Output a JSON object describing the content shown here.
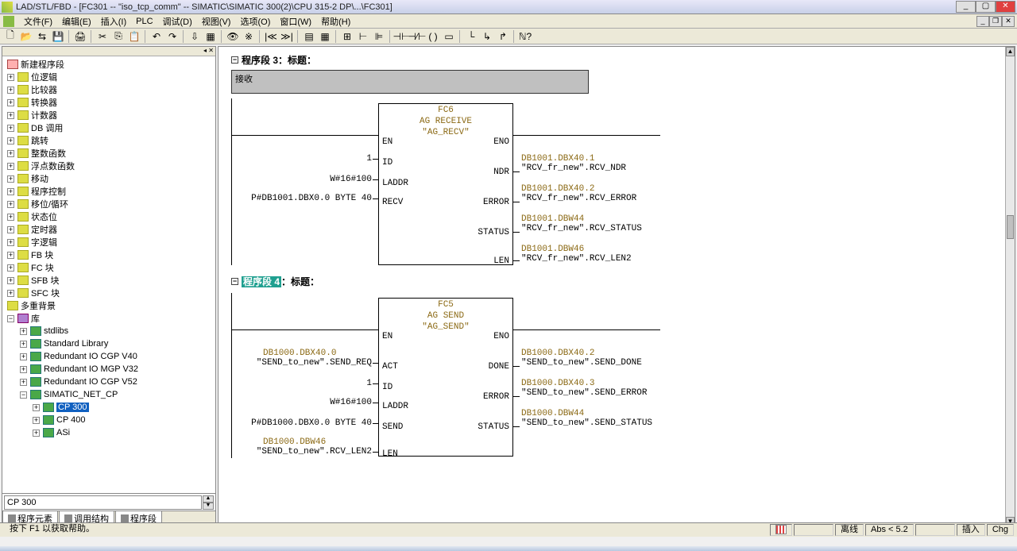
{
  "window": {
    "title": "LAD/STL/FBD  - [FC301 -- \"iso_tcp_comm\" -- SIMATIC\\SIMATIC 300(2)\\CPU 315-2 DP\\...\\FC301]"
  },
  "menu": {
    "file": "文件(F)",
    "edit": "编辑(E)",
    "insert": "插入(I)",
    "plc": "PLC",
    "debug": "调试(D)",
    "view": "视图(V)",
    "options": "选项(O)",
    "window": "窗口(W)",
    "help": "帮助(H)"
  },
  "tree": {
    "new_nw": "新建程序段",
    "bit_logic": "位逻辑",
    "compare": "比较器",
    "convert": "转换器",
    "counter": "计数器",
    "db_call": "DB 调用",
    "jumps": "跳转",
    "int_fn": "整数函数",
    "float_fn": "浮点数函数",
    "move": "移动",
    "prg_ctrl": "程序控制",
    "shift_rot": "移位/循环",
    "status": "状态位",
    "timer": "定时器",
    "word_logic": "字逻辑",
    "fb_blocks": "FB 块",
    "fc_blocks": "FC 块",
    "sfb_blocks": "SFB 块",
    "sfc_blocks": "SFC 块",
    "multi_inst": "多重背景",
    "library": "库",
    "stdlibs": "stdlibs",
    "std_library": "Standard Library",
    "red_io_v40": "Redundant IO CGP V40",
    "red_io_mgp": "Redundant IO MGP V32",
    "red_io_v52": "Redundant IO CGP V52",
    "simatic_net": "SIMATIC_NET_CP",
    "cp300": "CP 300",
    "cp400": "CP 400",
    "asi": "ASi"
  },
  "bottom_input": "CP 300",
  "bottom_tabs": {
    "elements": "程序元素",
    "call_struct": "调用结构",
    "networks": "程序段"
  },
  "network3": {
    "header_label": "程序段 3",
    "header_title": "：标题：",
    "comment": "接收"
  },
  "network4": {
    "header_label": "程序段 4",
    "header_title": "：标题："
  },
  "fc6": {
    "name": "FC6",
    "func": "AG RECEIVE",
    "sym": "\"AG_RECV\"",
    "in": {
      "EN": "EN",
      "ID": "ID",
      "LADDR": "LADDR",
      "RECV": "RECV"
    },
    "out": {
      "ENO": "ENO",
      "NDR": "NDR",
      "ERROR": "ERROR",
      "STATUS": "STATUS",
      "LEN": "LEN"
    },
    "in_vals": {
      "ID": "1",
      "LADDR": "W#16#100",
      "RECV": "P#DB1001.DBX0.0 BYTE 40"
    },
    "out_vals": {
      "NDR_addr": "DB1001.DBX40.1",
      "NDR_sym": "\"RCV_fr_new\".RCV_NDR",
      "ERROR_addr": "DB1001.DBX40.2",
      "ERROR_sym": "\"RCV_fr_new\".RCV_ERROR",
      "STATUS_addr": "DB1001.DBW44",
      "STATUS_sym": "\"RCV_fr_new\".RCV_STATUS",
      "LEN_addr": "DB1001.DBW46",
      "LEN_sym": "\"RCV_fr_new\".RCV_LEN2"
    }
  },
  "fc5": {
    "name": "FC5",
    "func": "AG SEND",
    "sym": "\"AG_SEND\"",
    "in": {
      "EN": "EN",
      "ACT": "ACT",
      "ID": "ID",
      "LADDR": "LADDR",
      "SEND": "SEND",
      "LEN": "LEN"
    },
    "out": {
      "ENO": "ENO",
      "DONE": "DONE",
      "ERROR": "ERROR",
      "STATUS": "STATUS"
    },
    "in_vals": {
      "ACT_addr": "DB1000.DBX40.0",
      "ACT_sym": "\"SEND_to_new\".SEND_REQ",
      "ID": "1",
      "LADDR": "W#16#100",
      "SEND": "P#DB1000.DBX0.0 BYTE 40",
      "LEN_addr": "DB1000.DBW46",
      "LEN_sym": "\"SEND_to_new\".RCV_LEN2"
    },
    "out_vals": {
      "DONE_addr": "DB1000.DBX40.2",
      "DONE_sym": "\"SEND_to_new\".SEND_DONE",
      "ERROR_addr": "DB1000.DBX40.3",
      "ERROR_sym": "\"SEND_to_new\".SEND_ERROR",
      "STATUS_addr": "DB1000.DBW44",
      "STATUS_sym": "\"SEND_to_new\".SEND_STATUS"
    }
  },
  "status": {
    "left": "按下 F1 以获取帮助。",
    "offline": "离线",
    "abs": "Abs < 5.2",
    "insert": "插入",
    "chg": "Chg"
  }
}
